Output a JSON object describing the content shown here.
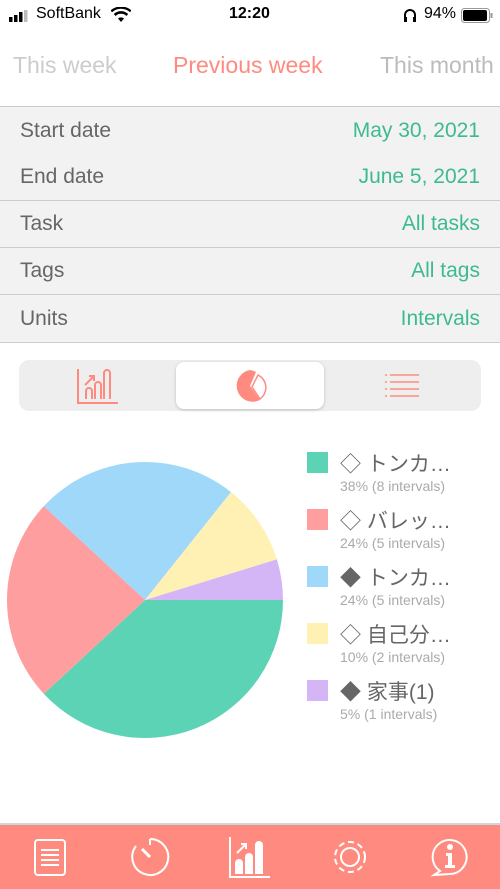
{
  "status": {
    "carrier": "SoftBank",
    "time": "12:20",
    "battery": "94%"
  },
  "periods": [
    {
      "label": "This week",
      "selected": false
    },
    {
      "label": "Previous week",
      "selected": true
    },
    {
      "label": "This month",
      "selected": false
    }
  ],
  "filters": [
    {
      "label": "Start date",
      "value": "May 30, 2021"
    },
    {
      "label": "End date",
      "value": "June 5, 2021"
    },
    {
      "label": "Task",
      "value": "All tasks"
    },
    {
      "label": "Tags",
      "value": "All tags"
    },
    {
      "label": "Units",
      "value": "Intervals"
    }
  ],
  "view_modes": [
    {
      "icon": "bar-chart-icon"
    },
    {
      "icon": "pie-chart-icon",
      "selected": true
    },
    {
      "icon": "list-icon"
    }
  ],
  "colors": {
    "accent": "#ff8b80",
    "value": "#3dbb8e"
  },
  "chart_data": {
    "type": "pie",
    "slices": [
      {
        "label": "◇ トンカ…",
        "percent": 38,
        "intervals": 8,
        "detail": "38% (8 intervals)",
        "color": "#5dd3b5"
      },
      {
        "label": "◇ バレッ…",
        "percent": 24,
        "intervals": 5,
        "detail": "24% (5 intervals)",
        "color": "#ff9e9e"
      },
      {
        "label": "◆ トンカ…",
        "percent": 24,
        "intervals": 5,
        "detail": "24% (5 intervals)",
        "color": "#a0d8fa"
      },
      {
        "label": "◇ 自己分…",
        "percent": 10,
        "intervals": 2,
        "detail": "10% (2 intervals)",
        "color": "#fff0b3"
      },
      {
        "label": "◆ 家事(1)",
        "percent": 5,
        "intervals": 1,
        "detail": "5% (1 intervals)",
        "color": "#d4b6f7"
      }
    ]
  },
  "tabbar": [
    {
      "icon": "document-icon"
    },
    {
      "icon": "timer-icon"
    },
    {
      "icon": "stats-icon",
      "selected": true
    },
    {
      "icon": "gear-icon"
    },
    {
      "icon": "info-icon"
    }
  ]
}
